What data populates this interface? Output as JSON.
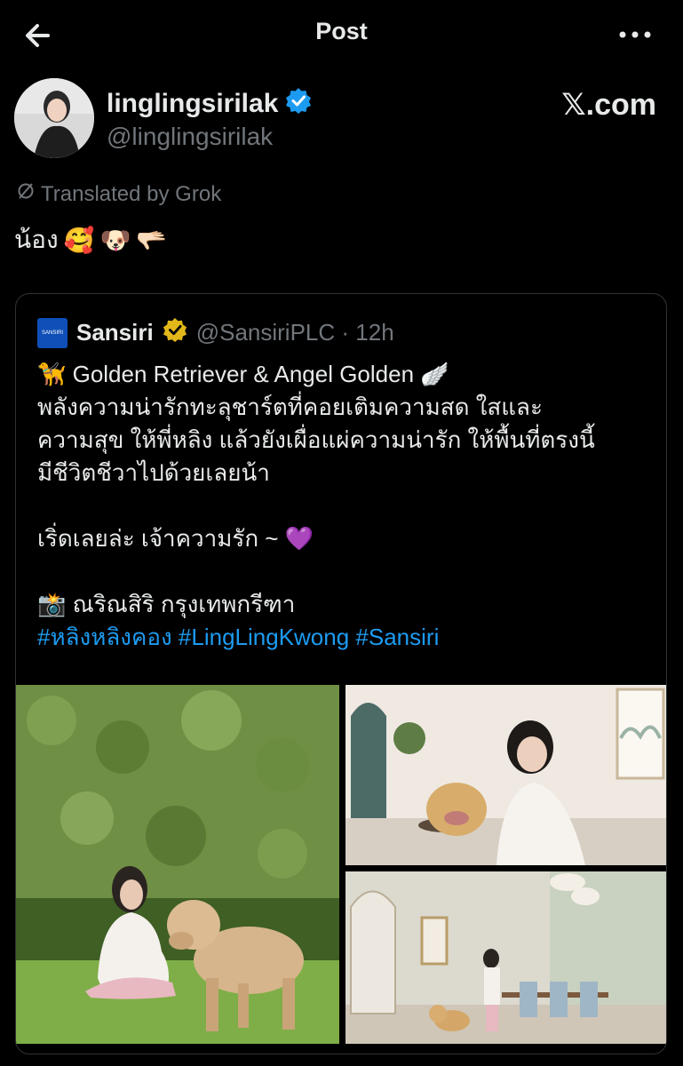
{
  "header": {
    "title": "Post"
  },
  "author": {
    "name": "linglingsirilak",
    "handle": "@linglingsirilak",
    "source": "𝕏.com"
  },
  "translation": {
    "label": "Translated by Grok"
  },
  "post": {
    "text": "น้อง",
    "emojis": [
      "🥰",
      "🐶",
      "🫳🏻"
    ]
  },
  "quote": {
    "logo_text": "SANSIRI",
    "name": "Sansiri",
    "meta": "@SansiriPLC · 12h",
    "lines": [
      "🦮 Golden Retriever & Angel Golden 🪽",
      "พลังความน่ารักทะลุชาร์ตที่คอยเติมความสด ใสและ",
      "ความสุข ให้พี่หลิง แล้วยังเผื่อแผ่ความน่ารัก ให้พื้นที่ตรงนี้",
      "มีชีวิตชีวาไปด้วยเลยน้า",
      "",
      "เริ่ดเลยล่ะ เจ้าความรัก ~ 💜",
      "",
      "📸 ณริณสิริ กรุงเทพกรีฑา"
    ],
    "hashtags": "#หลิงหลิงคอง #LingLingKwong #Sansiri"
  },
  "colors": {
    "background": "#000000",
    "text": "#e7e9ea",
    "muted": "#71767b",
    "link": "#1d9bf0",
    "verified": "#1d9bf0",
    "gold_badge": "#e2b719"
  },
  "icons": [
    "back-arrow-icon",
    "more-icon",
    "verified-badge-icon",
    "gold-verified-badge-icon",
    "grok-translate-icon"
  ]
}
